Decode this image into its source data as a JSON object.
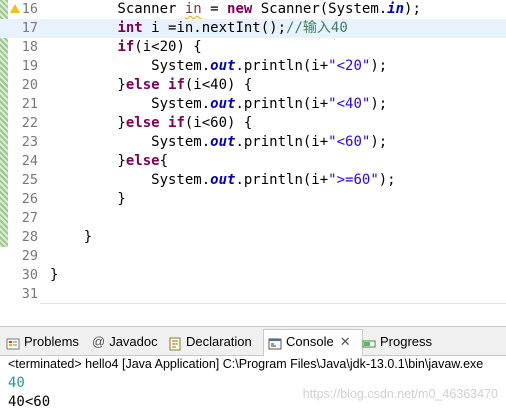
{
  "editor": {
    "lines": [
      {
        "n": "16",
        "segments": [
          {
            "t": "        Scanner ",
            "c": "plain"
          },
          {
            "t": "in",
            "c": "warn"
          },
          {
            "t": " = ",
            "c": "plain"
          },
          {
            "t": "new",
            "c": "kw"
          },
          {
            "t": " Scanner(System.",
            "c": "plain"
          },
          {
            "t": "in",
            "c": "fld"
          },
          {
            "t": ");",
            "c": "plain"
          }
        ]
      },
      {
        "n": "17",
        "segments": [
          {
            "t": "        ",
            "c": "plain"
          },
          {
            "t": "int",
            "c": "kw"
          },
          {
            "t": " i =in.nextInt();",
            "c": "plain"
          },
          {
            "t": "//输入40",
            "c": "cmt"
          }
        ]
      },
      {
        "n": "18",
        "segments": [
          {
            "t": "        ",
            "c": "plain"
          },
          {
            "t": "if",
            "c": "kw"
          },
          {
            "t": "(i<20) {",
            "c": "plain"
          }
        ]
      },
      {
        "n": "19",
        "segments": [
          {
            "t": "            System.",
            "c": "plain"
          },
          {
            "t": "out",
            "c": "fld"
          },
          {
            "t": ".println(i+",
            "c": "plain"
          },
          {
            "t": "\"<20\"",
            "c": "str"
          },
          {
            "t": ");",
            "c": "plain"
          }
        ]
      },
      {
        "n": "20",
        "segments": [
          {
            "t": "        }",
            "c": "plain"
          },
          {
            "t": "else",
            "c": "kw"
          },
          {
            "t": " ",
            "c": "plain"
          },
          {
            "t": "if",
            "c": "kw"
          },
          {
            "t": "(i<40) {",
            "c": "plain"
          }
        ]
      },
      {
        "n": "21",
        "segments": [
          {
            "t": "            System.",
            "c": "plain"
          },
          {
            "t": "out",
            "c": "fld"
          },
          {
            "t": ".println(i+",
            "c": "plain"
          },
          {
            "t": "\"<40\"",
            "c": "str"
          },
          {
            "t": ");",
            "c": "plain"
          }
        ]
      },
      {
        "n": "22",
        "segments": [
          {
            "t": "        }",
            "c": "plain"
          },
          {
            "t": "else",
            "c": "kw"
          },
          {
            "t": " ",
            "c": "plain"
          },
          {
            "t": "if",
            "c": "kw"
          },
          {
            "t": "(i<60) {",
            "c": "plain"
          }
        ]
      },
      {
        "n": "23",
        "segments": [
          {
            "t": "            System.",
            "c": "plain"
          },
          {
            "t": "out",
            "c": "fld"
          },
          {
            "t": ".println(i+",
            "c": "plain"
          },
          {
            "t": "\"<60\"",
            "c": "str"
          },
          {
            "t": ");",
            "c": "plain"
          }
        ]
      },
      {
        "n": "24",
        "segments": [
          {
            "t": "        }",
            "c": "plain"
          },
          {
            "t": "else",
            "c": "kw"
          },
          {
            "t": "{",
            "c": "plain"
          }
        ]
      },
      {
        "n": "25",
        "segments": [
          {
            "t": "            System.",
            "c": "plain"
          },
          {
            "t": "out",
            "c": "fld"
          },
          {
            "t": ".println(i+",
            "c": "plain"
          },
          {
            "t": "\">=60\"",
            "c": "str"
          },
          {
            "t": ");",
            "c": "plain"
          }
        ]
      },
      {
        "n": "26",
        "segments": [
          {
            "t": "        }",
            "c": "plain"
          }
        ]
      },
      {
        "n": "27",
        "segments": []
      },
      {
        "n": "28",
        "segments": [
          {
            "t": "    }",
            "c": "plain"
          }
        ]
      },
      {
        "n": "29",
        "segments": []
      },
      {
        "n": "30",
        "segments": [
          {
            "t": "}",
            "c": "plain"
          }
        ]
      },
      {
        "n": "31",
        "segments": []
      }
    ],
    "current_line": "17",
    "warning_line": "16"
  },
  "panel": {
    "tabs": {
      "problems": "Problems",
      "javadoc": "Javadoc",
      "declaration": "Declaration",
      "console": "Console",
      "progress": "Progress"
    },
    "javadoc_icon": "@",
    "console_close": "✕",
    "terminated": "<terminated> hello4 [Java Application] C:\\Program Files\\Java\\jdk-13.0.1\\bin\\javaw.exe",
    "output": [
      "40",
      "40<60"
    ],
    "watermark": "https://blog.csdn.net/m0_46363470"
  },
  "icons": {
    "warning": "warning-triangle-icon",
    "problems": "problems-icon",
    "declaration": "declaration-icon",
    "console": "console-icon",
    "progress": "progress-icon",
    "scroll_left": "scroll-left-icon"
  },
  "colors": {
    "keyword": "#7f0055",
    "field": "#0000c0",
    "string": "#2a00ff",
    "comment": "#3f7f5f",
    "current_line_bg": "#e8f2fe",
    "console_input": "#1f9e89"
  }
}
